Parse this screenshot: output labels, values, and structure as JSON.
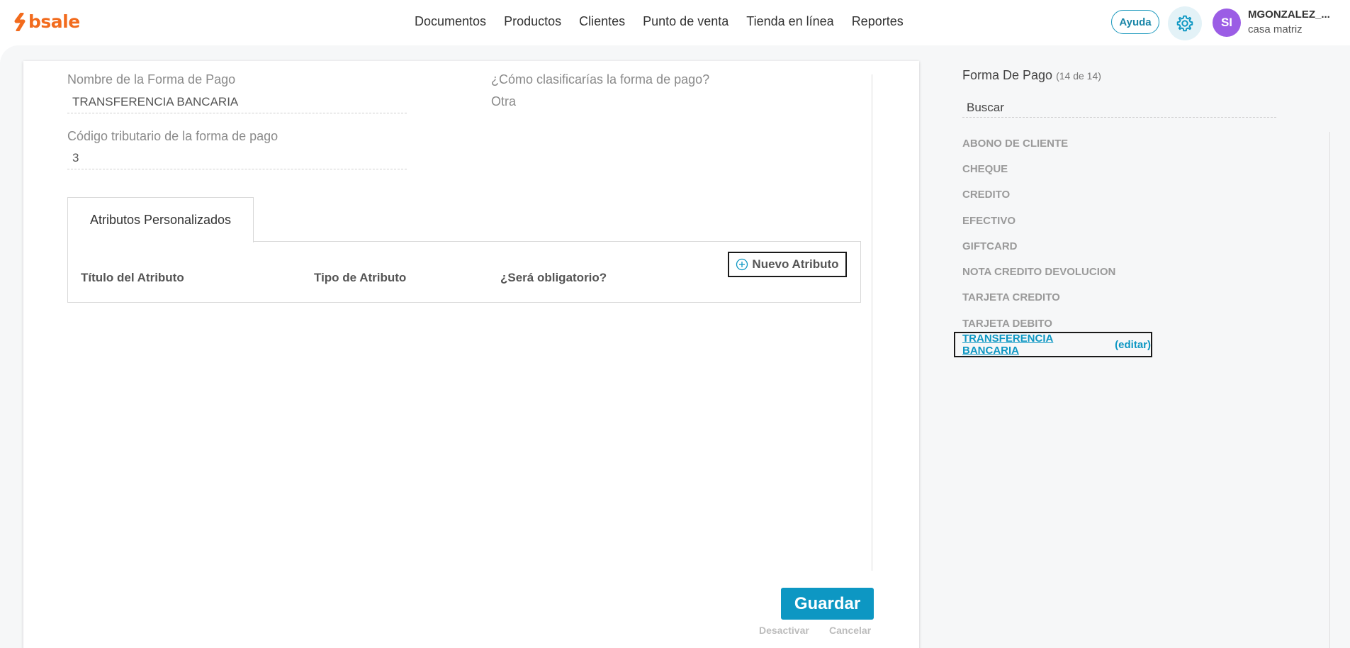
{
  "brand": {
    "name": "bsale",
    "color": "#f26b1d"
  },
  "nav": {
    "items": [
      "Documentos",
      "Productos",
      "Clientes",
      "Punto de venta",
      "Tienda en línea",
      "Reportes"
    ]
  },
  "header": {
    "help_label": "Ayuda",
    "avatar_initials": "SI",
    "user_name": "MGONZALEZ_...",
    "user_branch": "casa matriz"
  },
  "form": {
    "name_label": "Nombre de la Forma de Pago",
    "name_value": "TRANSFERENCIA BANCARIA",
    "class_label": "¿Cómo clasificarías la forma de pago?",
    "class_value": "Otra",
    "tax_code_label": "Código tributario de la forma de pago",
    "tax_code_value": "3"
  },
  "attributes": {
    "tab_label": "Atributos Personalizados",
    "columns": [
      "Título del Atributo",
      "Tipo de Atributo",
      "¿Será obligatorio?"
    ],
    "new_button": "Nuevo Atributo"
  },
  "footer": {
    "save_label": "Guardar",
    "deactivate_label": "Desactivar",
    "cancel_label": "Cancelar"
  },
  "sidebar": {
    "title": "Forma De Pago",
    "count": "(14 de 14)",
    "search_value": "Buscar",
    "items": [
      "ABONO DE CLIENTE",
      "CHEQUE",
      "CREDITO",
      "EFECTIVO",
      "GIFTCARD",
      "NOTA CREDITO DEVOLUCION",
      "TARJETA CREDITO",
      "TARJETA DEBITO"
    ],
    "active_item": "TRANSFERENCIA BANCARIA",
    "edit_label": "(editar)"
  },
  "colors": {
    "accent": "#0d97c3",
    "avatar": "#9b5de5"
  }
}
